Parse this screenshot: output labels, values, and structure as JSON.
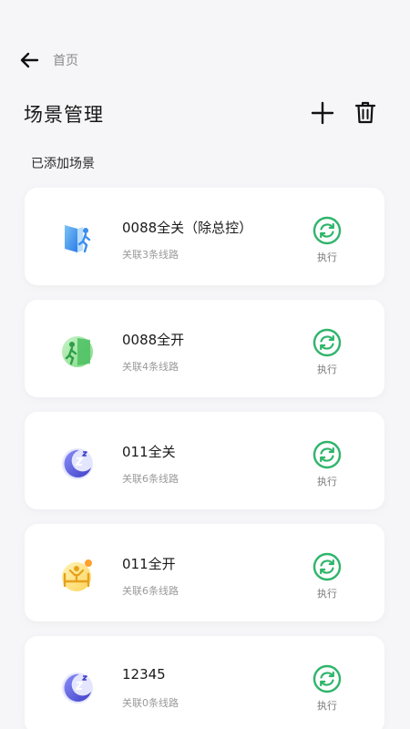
{
  "nav": {
    "back_icon": "arrow-left-icon",
    "crumb": "首页"
  },
  "header": {
    "title": "场景管理",
    "add_icon": "plus-icon",
    "delete_icon": "trash-icon"
  },
  "section_label": "已添加场景",
  "colors": {
    "accent_green": "#2fb56a",
    "background": "#f6f6f8",
    "card": "#ffffff"
  },
  "scenes": [
    {
      "name": "0088全关（除总控）",
      "sub": "关联3条线路",
      "icon": "exit-door-icon",
      "exec_label": "执行"
    },
    {
      "name": "0088全开",
      "sub": "关联4条线路",
      "icon": "enter-door-icon",
      "exec_label": "执行"
    },
    {
      "name": "011全关",
      "sub": "关联6条线路",
      "icon": "moon-sleep-icon",
      "exec_label": "执行"
    },
    {
      "name": "011全开",
      "sub": "关联6条线路",
      "icon": "wake-up-icon",
      "exec_label": "执行"
    },
    {
      "name": "12345",
      "sub": "关联0条线路",
      "icon": "moon-sleep-icon",
      "exec_label": "执行"
    }
  ]
}
